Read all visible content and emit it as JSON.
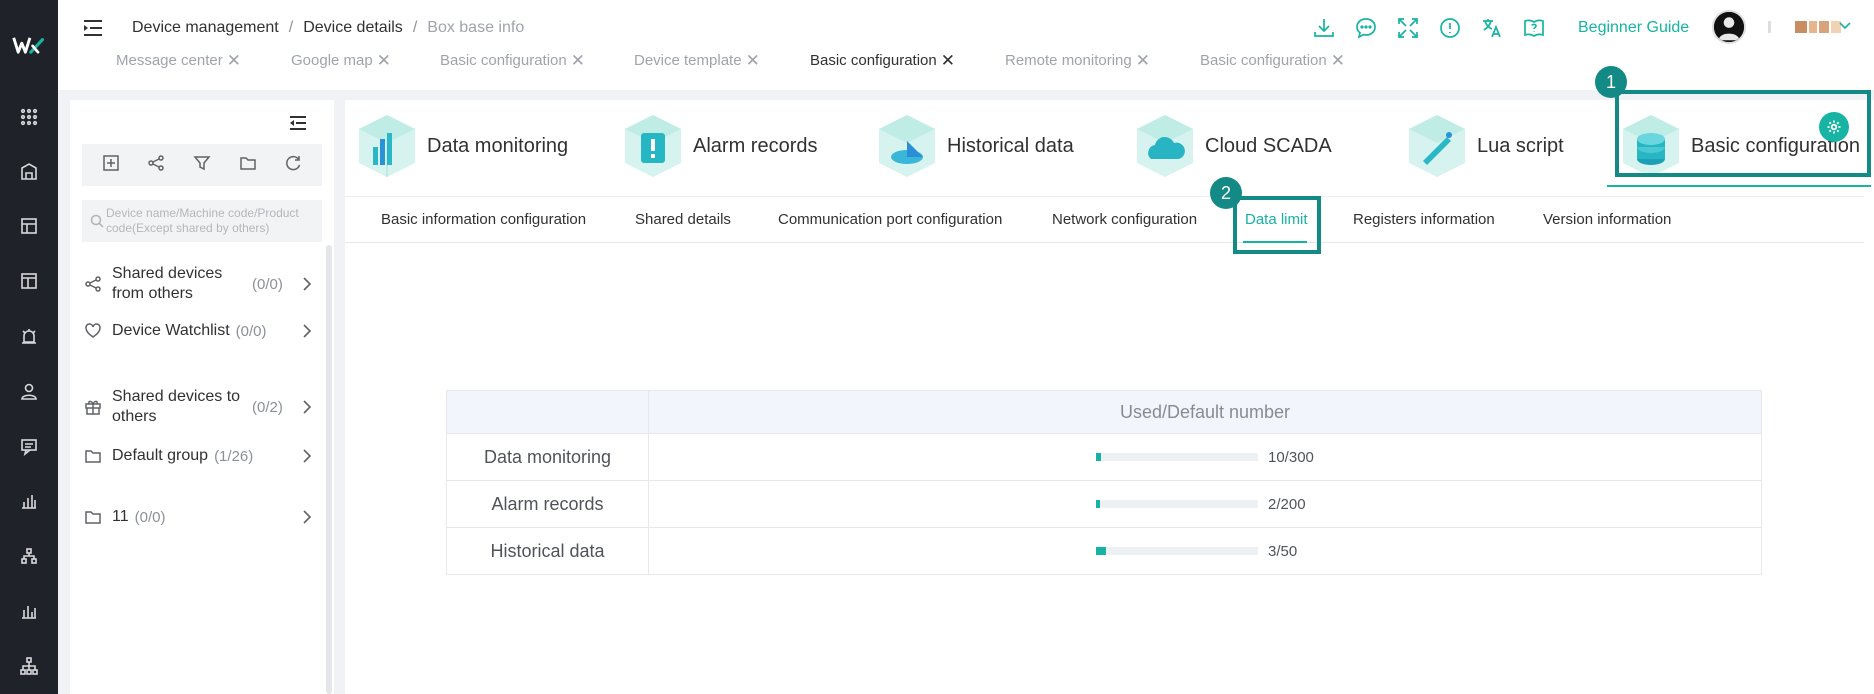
{
  "header": {
    "breadcrumb": [
      "Device management",
      "Device details",
      "Box base info"
    ],
    "guide_label": "Beginner Guide"
  },
  "page_tabs": [
    {
      "label": "Message center"
    },
    {
      "label": "Google map"
    },
    {
      "label": "Basic configuration"
    },
    {
      "label": "Device template"
    },
    {
      "label": "Basic configuration"
    },
    {
      "label": "Remote monitoring"
    },
    {
      "label": "Basic configuration"
    }
  ],
  "sidebar": {
    "search_placeholder": "Device name/Machine code/Product code(Except shared by others)",
    "groups": [
      {
        "name": "Shared devices from others",
        "count": "(0/0)"
      },
      {
        "name": "Device Watchlist",
        "count": "(0/0)"
      },
      {
        "name": "Shared devices to others",
        "count": "(0/2)"
      },
      {
        "name": "Default group",
        "count": "(1/26)"
      },
      {
        "name": "11",
        "count": "(0/0)"
      }
    ]
  },
  "modules": [
    {
      "label": "Data monitoring"
    },
    {
      "label": "Alarm records"
    },
    {
      "label": "Historical data"
    },
    {
      "label": "Cloud SCADA"
    },
    {
      "label": "Lua script"
    },
    {
      "label": "Basic configuration"
    }
  ],
  "sub_tabs": [
    {
      "label": "Basic information configuration"
    },
    {
      "label": "Shared details"
    },
    {
      "label": "Communication port configuration"
    },
    {
      "label": "Network configuration"
    },
    {
      "label": "Data limit"
    },
    {
      "label": "Registers information"
    },
    {
      "label": "Version information"
    }
  ],
  "badges": {
    "first": "1",
    "second": "2"
  },
  "limits": {
    "column_header": "Used/Default number",
    "rows": [
      {
        "label": "Data monitoring",
        "used": 10,
        "total": 300,
        "text": "10/300"
      },
      {
        "label": "Alarm records",
        "used": 2,
        "total": 200,
        "text": "2/200"
      },
      {
        "label": "Historical data",
        "used": 3,
        "total": 50,
        "text": "3/50"
      }
    ]
  },
  "colors": {
    "accent": "#17b3a3",
    "highlight": "#148a86",
    "rail": "#1f2329"
  }
}
